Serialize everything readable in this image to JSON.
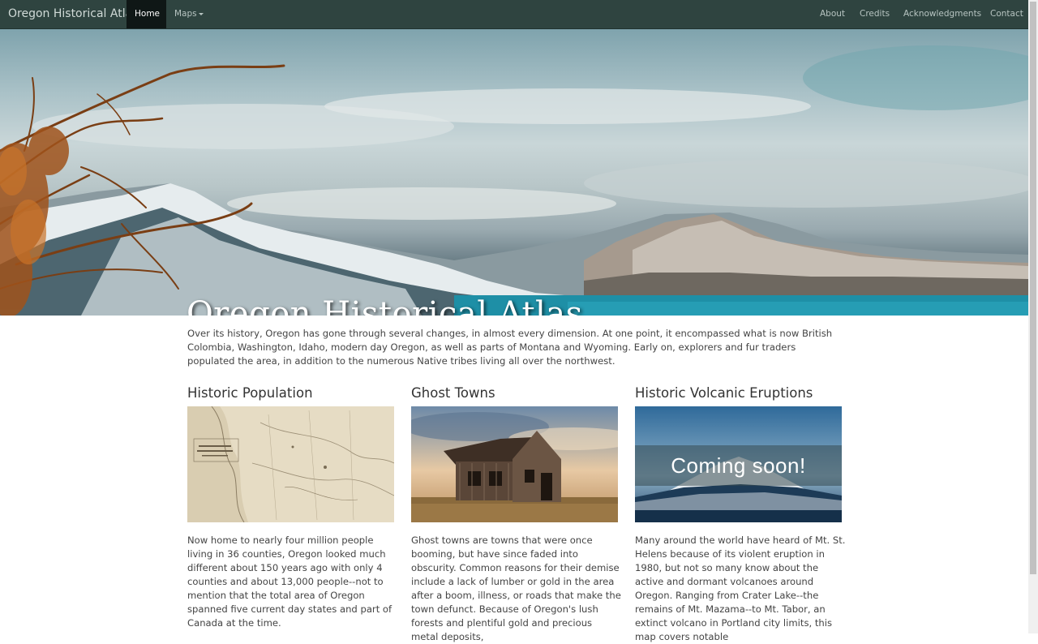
{
  "navbar": {
    "brand": "Oregon Historical Atlas",
    "items": [
      {
        "label": "Home",
        "active": true
      },
      {
        "label": "Maps",
        "dropdown": true
      }
    ],
    "right_items": [
      {
        "label": "About"
      },
      {
        "label": "Credits"
      },
      {
        "label": "Acknowledgments"
      },
      {
        "label": "Contact"
      }
    ]
  },
  "hero": {
    "title": "Oregon Historical Atlas"
  },
  "intro": "Over its history, Oregon has gone through several changes, in almost every dimension. At one point, it encompassed what is now British Colombia, Washington, Idaho, modern day Oregon, as well as parts of Montana and Wyoming. Early on, explorers and fur traders populated the area, in addition to the numerous Native tribes living all over the northwest.",
  "cards": [
    {
      "title": "Historic Population",
      "image": "historic-map",
      "text": "Now home to nearly four million people living in 36 counties, Oregon looked much different about 150 years ago with only 4 counties and about 13,000 people--not to mention that the total area of Oregon spanned five current day states and part of Canada at the time."
    },
    {
      "title": "Ghost Towns",
      "image": "abandoned-house",
      "text": "Ghost towns are towns that were once booming, but have since faded into obscurity. Common reasons for their demise include a lack of lumber or gold in the area after a boom, illness, or roads that make the town defunct. Because of Oregon's lush forests and plentiful gold and precious metal deposits,"
    },
    {
      "title": "Historic Volcanic Eruptions",
      "image": "snowy-mountain",
      "overlay": "Coming soon!",
      "text": "Many around the world have heard of Mt. St. Helens because of its violent eruption in 1980, but not so many know about the active and dormant volcanoes around Oregon. Ranging from Crater Lake--the remains of Mt. Mazama--to Mt. Tabor, an extinct volcano in Portland city limits, this map covers notable"
    }
  ]
}
